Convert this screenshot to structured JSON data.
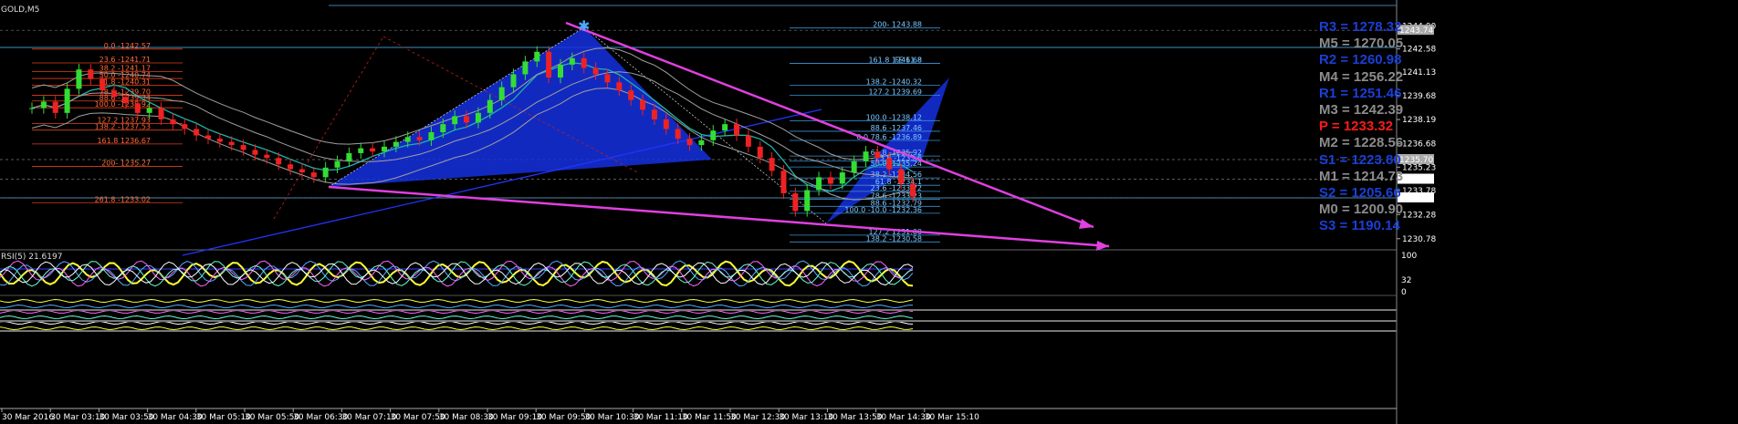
{
  "window": {
    "symbol_label": "GOLD,M5"
  },
  "rsi": {
    "label": "RSI(5) 21.6197",
    "ticks": [
      "100",
      "32",
      "0"
    ]
  },
  "pivots": [
    {
      "label": "R3 = 1278.32",
      "color": "#1a3fd6"
    },
    {
      "label": "M5 = 1270.05",
      "color": "#8c8c8c"
    },
    {
      "label": "R2 = 1260.98",
      "color": "#1a3fd6"
    },
    {
      "label": "M4 = 1256.22",
      "color": "#8c8c8c"
    },
    {
      "label": "R1 = 1251.46",
      "color": "#1a3fd6"
    },
    {
      "label": "M3 = 1242.39",
      "color": "#8c8c8c"
    },
    {
      "label": "P   = 1233.32",
      "color": "#ff1a1a"
    },
    {
      "label": "M2 = 1228.56",
      "color": "#8c8c8c"
    },
    {
      "label": "S1 = 1223.80",
      "color": "#1a3fd6"
    },
    {
      "label": "M1 = 1214.73",
      "color": "#8c8c8c"
    },
    {
      "label": "S2 = 1205.66",
      "color": "#1a3fd6"
    },
    {
      "label": "M0 = 1200.90",
      "color": "#8c8c8c"
    },
    {
      "label": "S3 = 1190.14",
      "color": "#1a3fd6"
    }
  ],
  "chart_data": {
    "type": "candlestick",
    "title": "GOLD,M5",
    "ylim": [
      1230.2,
      1244.6
    ],
    "y_ticks": [
      "1244.00",
      "1242.58",
      "1241.13",
      "1239.68",
      "1238.19",
      "1236.68",
      "1235.23",
      "1233.78",
      "1232.28",
      "1230.78"
    ],
    "x_ticks": [
      "30 Mar 2016",
      "30 Mar 03:10",
      "30 Mar 03:50",
      "30 Mar 04:30",
      "30 Mar 05:10",
      "30 Mar 05:50",
      "30 Mar 06:30",
      "30 Mar 07:10",
      "30 Mar 07:50",
      "30 Mar 08:30",
      "30 Mar 09:10",
      "30 Mar 09:50",
      "30 Mar 10:30",
      "30 Mar 11:10",
      "30 Mar 11:50",
      "30 Mar 12:30",
      "30 Mar 13:10",
      "30 Mar 13:50",
      "30 Mar 14:30",
      "30 Mar 15:10"
    ],
    "price_boxes": [
      {
        "label": "1243.74",
        "value": 1243.74,
        "bg": "#a9a9a9"
      },
      {
        "label": "1235.70",
        "value": 1235.7,
        "bg": "#a9a9a9"
      },
      {
        "label": "1234.48",
        "value": 1234.48,
        "bg": "#ffffff"
      },
      {
        "label": "1233.32",
        "value": 1233.32,
        "bg": "#ffffff"
      }
    ],
    "closes": [
      1238.9,
      1239.3,
      1238.6,
      1240.1,
      1241.3,
      1240.7,
      1240.0,
      1239.6,
      1239.2,
      1238.6,
      1238.9,
      1238.2,
      1237.9,
      1237.6,
      1237.2,
      1237.0,
      1236.8,
      1236.6,
      1236.3,
      1236.0,
      1235.8,
      1235.4,
      1235.1,
      1234.9,
      1234.6,
      1235.2,
      1235.6,
      1236.1,
      1236.4,
      1236.2,
      1236.5,
      1236.8,
      1237.1,
      1236.9,
      1237.4,
      1237.9,
      1238.4,
      1238.0,
      1238.6,
      1239.4,
      1240.2,
      1241.0,
      1241.8,
      1242.4,
      1240.8,
      1241.6,
      1242.0,
      1241.4,
      1241.0,
      1240.5,
      1240.0,
      1239.4,
      1238.8,
      1238.2,
      1237.6,
      1237.0,
      1236.6,
      1236.9,
      1237.5,
      1237.9,
      1237.2,
      1236.5,
      1235.8,
      1235.0,
      1233.6,
      1232.5,
      1233.8,
      1234.6,
      1234.2,
      1234.9,
      1235.6,
      1236.2,
      1235.8,
      1235.1,
      1234.2,
      1233.4
    ],
    "fib_left": [
      {
        "label": "0.0 -1242.57",
        "value": 1242.57
      },
      {
        "label": "23.6 -1241.71",
        "value": 1241.71
      },
      {
        "label": "38.2 -1241.17",
        "value": 1241.17
      },
      {
        "label": "50.0 -1240.74",
        "value": 1240.74
      },
      {
        "label": "61.8 -1240.31",
        "value": 1240.31
      },
      {
        "label": "78.6 -1239.70",
        "value": 1239.7
      },
      {
        "label": "88.6 -1239.34",
        "value": 1239.34
      },
      {
        "label": "100.0 -1238.92",
        "value": 1238.92
      },
      {
        "label": "127.2 1237.93",
        "value": 1237.93
      },
      {
        "label": "138.2 -1237.53",
        "value": 1237.53
      },
      {
        "label": "161.8 1236.67",
        "value": 1236.67
      },
      {
        "label": "200- 1235.27",
        "value": 1235.27
      },
      {
        "label": "261.8 -1233.02",
        "value": 1233.02
      }
    ],
    "fib_right": [
      {
        "label": "200- 1243.88",
        "value": 1243.88
      },
      {
        "label": "FE 61.8",
        "value": 1241.68
      },
      {
        "label": "161.8 1241.68",
        "value": 1241.68
      },
      {
        "label": "138.2 -1240.32",
        "value": 1240.32
      },
      {
        "label": "127.2 1239.69",
        "value": 1239.69
      },
      {
        "label": "100.0 -1238.12",
        "value": 1238.12
      },
      {
        "label": "88.6 -1237.46",
        "value": 1237.46
      },
      {
        "label": "0.0 78.6 -1236.89",
        "value": 1236.89
      },
      {
        "label": "61.8 -1235.92",
        "value": 1235.92
      },
      {
        "label": "23.6 -1235.6",
        "value": 1235.6
      },
      {
        "label": "50.0 -1235.24",
        "value": 1235.24
      },
      {
        "label": "38.2 -1234.56",
        "value": 1234.56
      },
      {
        "label": "61.8 -1234.1",
        "value": 1234.1
      },
      {
        "label": "23.6 -1233.72",
        "value": 1233.72
      },
      {
        "label": "78.6 -1233.23",
        "value": 1233.23
      },
      {
        "label": "88.6 -1232.79",
        "value": 1232.79
      },
      {
        "label": "100.0 -10.0 -1232.36",
        "value": 1232.36
      },
      {
        "label": "127.2 1231.00",
        "value": 1231.0
      },
      {
        "label": "138.2 -1230.58",
        "value": 1230.58
      }
    ]
  }
}
